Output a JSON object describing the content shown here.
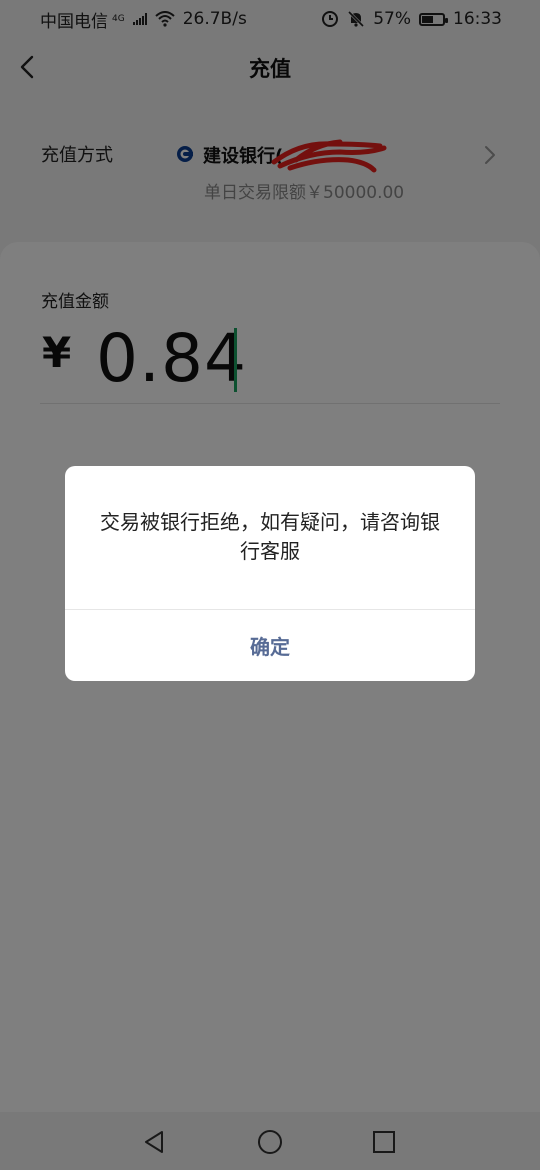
{
  "status_bar": {
    "carrier": "中国电信",
    "network_type": "4G",
    "speed": "26.7B/s",
    "battery": "57%",
    "battery_level": 0.57,
    "time": "16:33"
  },
  "nav": {
    "title": "充值"
  },
  "method": {
    "label": "充值方式",
    "bank_name": "建设银行(",
    "limit_text": "单日交易限额￥50000.00"
  },
  "amount": {
    "label": "充值金额",
    "currency": "¥",
    "value": "0.84"
  },
  "dialog": {
    "message": "交易被银行拒绝，如有疑问，请咨询银行客服",
    "confirm_label": "确定"
  },
  "colors": {
    "accent_link": "#576b95",
    "cursor": "#1aa260",
    "scribble": "#e8201c"
  }
}
